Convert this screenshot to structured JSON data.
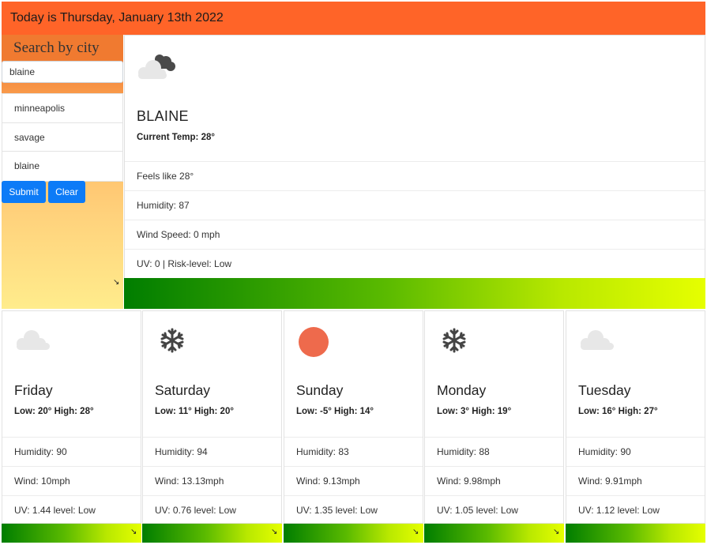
{
  "header": {
    "date_text": "Today is Thursday, January 13th 2022",
    "bg_color": "#ff6428"
  },
  "sidebar": {
    "title": "Search by city",
    "search": {
      "value": "blaine",
      "placeholder": ""
    },
    "history": [
      "minneapolis",
      "savage",
      "blaine"
    ],
    "submit_label": "Submit",
    "clear_label": "Clear",
    "button_color": "#0d7bf7",
    "resize_glyph": "↘"
  },
  "current": {
    "icon": "cloud-night-icon",
    "city": "BLAINE",
    "temp": "Current Temp: 28°",
    "feels_like": "Feels like 28°",
    "humidity": "Humidity: 87",
    "wind": "Wind Speed: 0 mph",
    "uv": "UV: 0 | Risk-level: Low"
  },
  "forecast": [
    {
      "icon": "cloud-icon",
      "day": "Friday",
      "lowhigh": "Low: 20° High: 28°",
      "humidity": "Humidity: 90",
      "wind": "Wind: 10mph",
      "uv": "UV: 1.44 level: Low"
    },
    {
      "icon": "snowflake-icon",
      "day": "Saturday",
      "lowhigh": "Low: 11° High: 20°",
      "humidity": "Humidity: 94",
      "wind": "Wind: 13.13mph",
      "uv": "UV: 0.76 level: Low"
    },
    {
      "icon": "sun-icon",
      "day": "Sunday",
      "lowhigh": "Low: -5° High: 14°",
      "humidity": "Humidity: 83",
      "wind": "Wind: 9.13mph",
      "uv": "UV: 1.35 level: Low"
    },
    {
      "icon": "snowflake-icon",
      "day": "Monday",
      "lowhigh": "Low: 3° High: 19°",
      "humidity": "Humidity: 88",
      "wind": "Wind: 9.98mph",
      "uv": "UV: 1.05 level: Low"
    },
    {
      "icon": "cloud-icon",
      "day": "Tuesday",
      "lowhigh": "Low: 16° High: 27°",
      "humidity": "Humidity: 90",
      "wind": "Wind: 9.91mph",
      "uv": "UV: 1.12 level: Low"
    }
  ],
  "colors": {
    "uv_gradient_start": "#007d00",
    "uv_gradient_end": "#e6ff00",
    "sun": "#ee6a4c"
  }
}
